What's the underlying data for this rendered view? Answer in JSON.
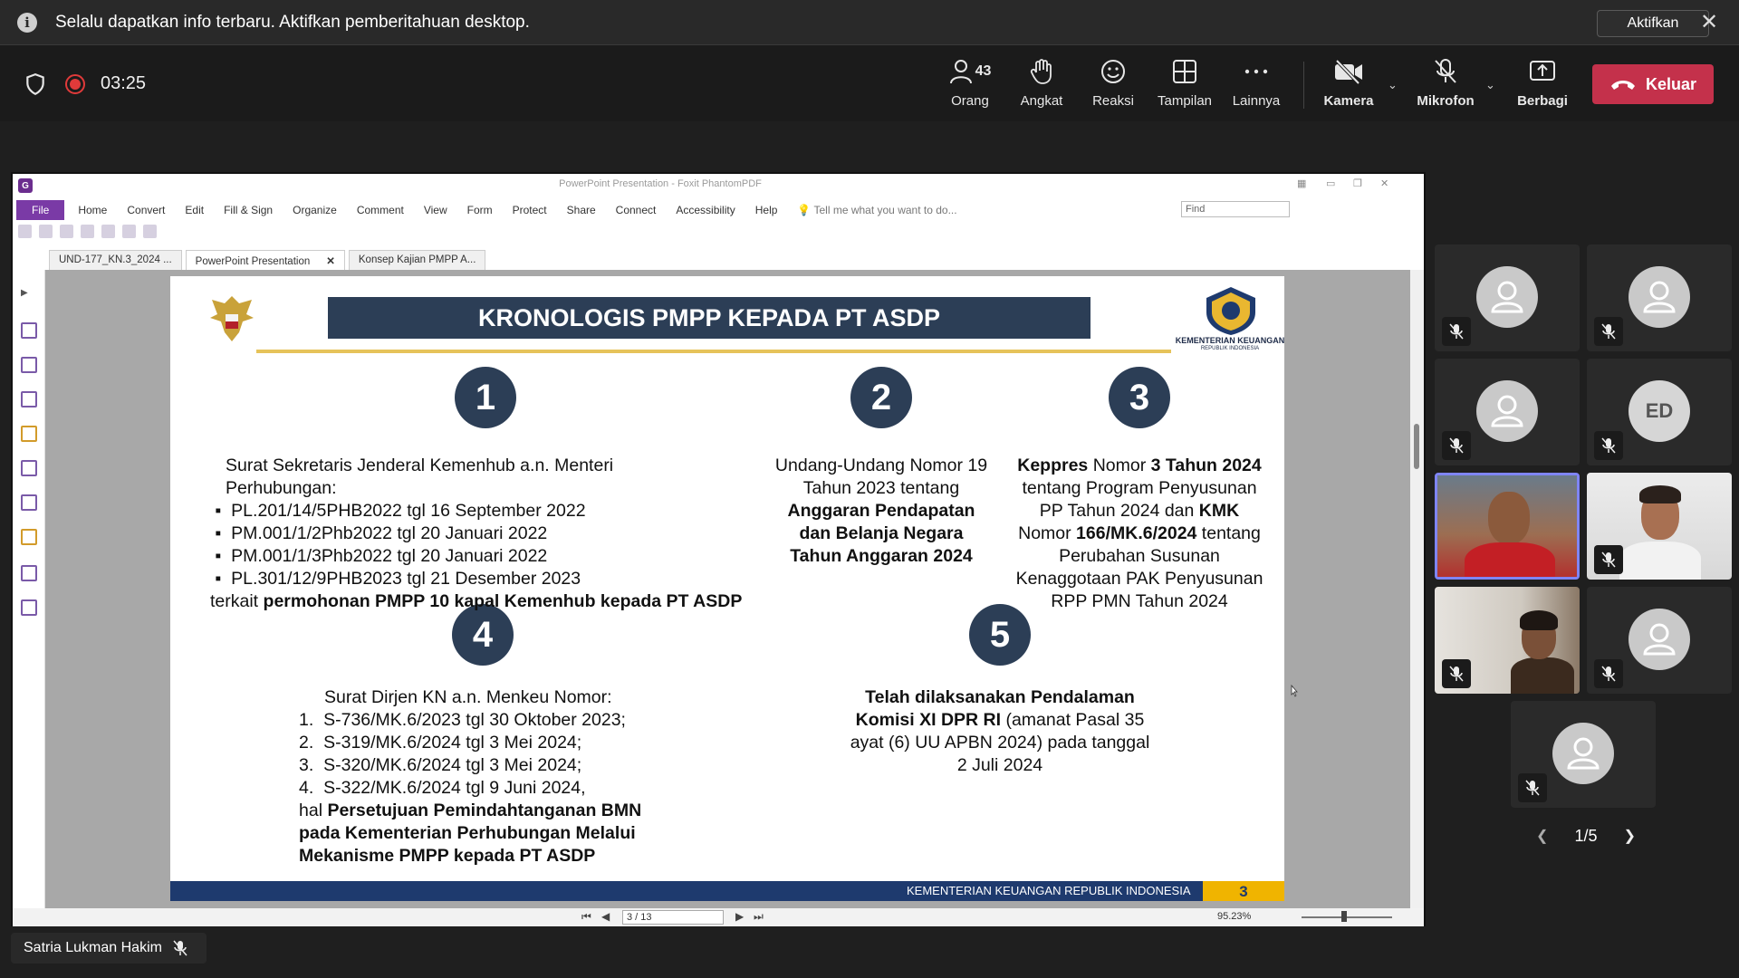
{
  "notification": {
    "message": "Selalu dapatkan info terbaru. Aktifkan pemberitahuan desktop.",
    "enable_label": "Aktifkan",
    "close_glyph": "✕"
  },
  "toolbar": {
    "timer": "03:25",
    "people_count": "43",
    "people_label": "Orang",
    "raise_label": "Angkat",
    "react_label": "Reaksi",
    "view_label": "Tampilan",
    "more_label": "Lainnya",
    "camera_label": "Kamera",
    "mic_label": "Mikrofon",
    "share_label": "Berbagi",
    "leave_label": "Keluar",
    "leave_color": "#c4314b"
  },
  "pdf": {
    "window_title": "PowerPoint Presentation - Foxit PhantomPDF",
    "menu": [
      "File",
      "Home",
      "Convert",
      "Edit",
      "Fill & Sign",
      "Organize",
      "Comment",
      "View",
      "Form",
      "Protect",
      "Share",
      "Connect",
      "Accessibility",
      "Help"
    ],
    "tell_me": "Tell me what you want to do...",
    "search_placeholder": "Find",
    "tabs": [
      "UND-177_KN.3_2024 ...",
      "PowerPoint Presentation",
      "Konsep Kajian PMPP A..."
    ],
    "page_indicator": "3 / 13",
    "zoom": "95.23%"
  },
  "slide": {
    "title": "KRONOLOGIS PMPP KEPADA PT ASDP",
    "kemenkeu": "KEMENTERIAN KEUANGAN",
    "kemenkeu_sub": "REPUBLIK INDONESIA",
    "footer": "KEMENTERIAN KEUANGAN REPUBLIK INDONESIA",
    "footer_page": "3",
    "numbers": [
      "1",
      "2",
      "3",
      "4",
      "5"
    ],
    "b1": {
      "intro": "Surat Sekretaris Jenderal Kemenhub a.n. Menteri Perhubungan:",
      "items": [
        "PL.201/14/5PHB2022 tgl 16 September 2022",
        "PM.001/1/2Phb2022 tgl 20 Januari 2022",
        "PM.001/1/3Phb2022 tgl 20 Januari 2022",
        "PL.301/12/9PHB2023 tgl 21 Desember 2023"
      ],
      "tail_plain": "terkait ",
      "tail_bold": "permohonan PMPP 10 kapal Kemenhub kepada PT ASDP"
    },
    "b2": {
      "line1": "Undang-Undang Nomor 19",
      "line2": "Tahun 2023 tentang",
      "bold1": "Anggaran Pendapatan",
      "bold2": "dan Belanja Negara",
      "bold3": "Tahun Anggaran 2024"
    },
    "b3": {
      "keppres": "Keppres",
      "nomor": " Nomor ",
      "tahun": "3 Tahun 2024",
      "l2": "tentang Program Penyusunan",
      "l3a": "PP Tahun 2024 dan ",
      "kmk": "KMK",
      "l4a": "Nomor ",
      "kmk_no": "166/MK.6/2024",
      "l4b": " tentang",
      "l5": "Perubahan Susunan",
      "l6": "Kenaggotaan PAK Penyusunan",
      "l7": "RPP PMN Tahun 2024"
    },
    "b4": {
      "intro": "Surat Dirjen KN a.n. Menkeu Nomor:",
      "items": [
        "1.  S-736/MK.6/2023 tgl 30 Oktober 2023;",
        "2.  S-319/MK.6/2024 tgl 3 Mei 2024;",
        "3.  S-320/MK.6/2024 tgl 3 Mei 2024;",
        "4.  S-322/MK.6/2024 tgl 9 Juni 2024,"
      ],
      "hal": "hal ",
      "bold1": "Persetujuan Pemindahtanganan BMN",
      "bold2": "pada Kementerian Perhubungan Melalui",
      "bold3": "Mekanisme PMPP kepada PT ASDP"
    },
    "b5": {
      "bold1": "Telah dilaksanakan Pendalaman",
      "bold2": "Komisi XI DPR RI",
      "plain2": " (amanat Pasal 35",
      "line3": "ayat (6) UU APBN 2024) pada tanggal",
      "line4": "2 Juli 2024"
    }
  },
  "participants": {
    "initials": "ED",
    "page": "1/5",
    "active_border": "#7f85f5"
  },
  "presenter": {
    "name": "Satria Lukman Hakim"
  }
}
